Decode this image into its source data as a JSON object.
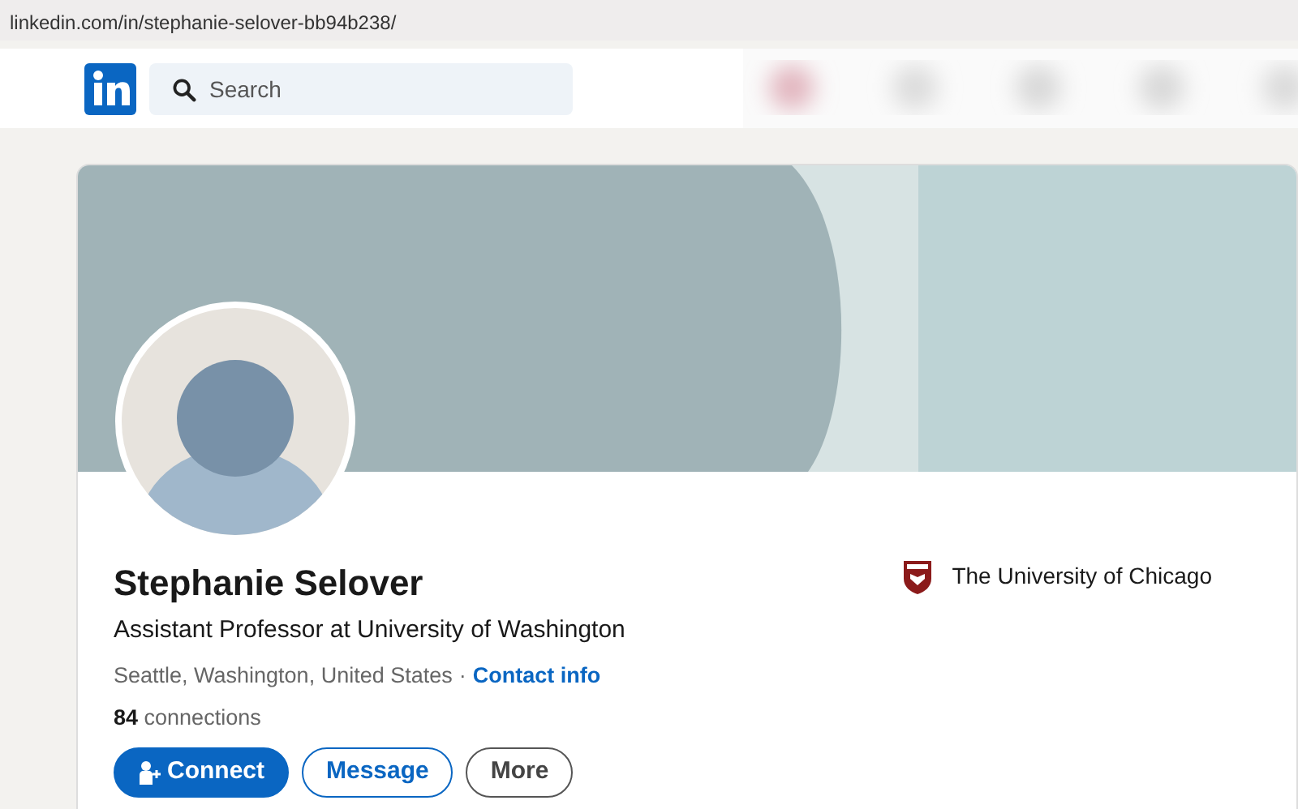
{
  "browser": {
    "url": "linkedin.com/in/stephanie-selover-bb94b238/"
  },
  "navbar": {
    "search": {
      "placeholder": "Search"
    }
  },
  "profile": {
    "name": "Stephanie Selover",
    "headline": "Assistant Professor at University of Washington",
    "location": "Seattle, Washington, United States",
    "separator": "·",
    "contact_link": "Contact info",
    "connections": "**84** connections",
    "education": "The University of Chicago",
    "buttons": [
      {
        "label": "Connect",
        "kind": "primary"
      },
      {
        "label": "Message",
        "kind": "outline"
      },
      {
        "label": "More",
        "kind": "neutral"
      }
    ]
  }
}
